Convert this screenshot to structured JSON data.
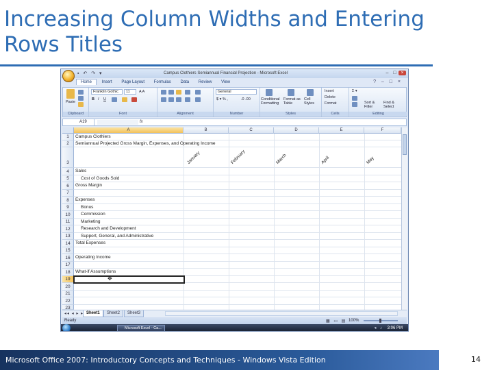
{
  "slide": {
    "title": "Increasing Column Widths and Entering Rows Titles",
    "footer": "Microsoft Office 2007: Introductory Concepts and Techniques - Windows Vista Edition",
    "page_number": "14",
    "title_color": "#2e6db4"
  },
  "excel": {
    "window_title": "Campus Clothiers Semiannual Financial Projection - Microsoft Excel",
    "tabs": [
      "Home",
      "Insert",
      "Page Layout",
      "Formulas",
      "Data",
      "Review",
      "View"
    ],
    "ribbon": {
      "paste": "Paste",
      "font_name": "Franklin Gothic",
      "font_size": "11",
      "number_format": "General",
      "conditional_formatting": "Conditional Formatting",
      "format_as_table": "Format as Table",
      "cell_styles": "Cell Styles",
      "insert": "Insert",
      "delete": "Delete",
      "format": "Format",
      "sort_filter": "Sort & Filter",
      "find_select": "Find & Select",
      "groups": [
        "Clipboard",
        "Font",
        "Alignment",
        "Number",
        "Styles",
        "Cells",
        "Editing"
      ]
    },
    "name_box": "A19",
    "fx": "fx",
    "columns": [
      "A",
      "B",
      "C",
      "D",
      "E",
      "F"
    ],
    "rows": [
      "1",
      "2",
      "3",
      "4",
      "5",
      "6",
      "7",
      "8",
      "9",
      "10",
      "11",
      "12",
      "13",
      "14",
      "15",
      "16",
      "17",
      "18",
      "19",
      "20",
      "21",
      "22",
      "23"
    ],
    "cells": {
      "r1": "Campus Clothiers",
      "r2": "Semiannual Projected Gross Margin, Expenses, and Operating Income",
      "r4": "Sales",
      "r5": "Cost of Goods Sold",
      "r6": "Gross Margin",
      "r8": "Expenses",
      "r9": "Bonus",
      "r10": "Commission",
      "r11": "Marketing",
      "r12": "Research and Development",
      "r13": "Support, General, and Administrative",
      "r14": "Total Expenses",
      "r16": "Operating Income",
      "r18": "What-if Assumptions"
    },
    "months": [
      "January",
      "February",
      "March",
      "April",
      "May"
    ],
    "sheet_tabs": [
      "Sheet1",
      "Sheet2",
      "Sheet3"
    ],
    "status": "Ready",
    "zoom": "100%",
    "taskbar_item": "Microsoft Excel - Ca...",
    "clock": "3:06 PM"
  }
}
